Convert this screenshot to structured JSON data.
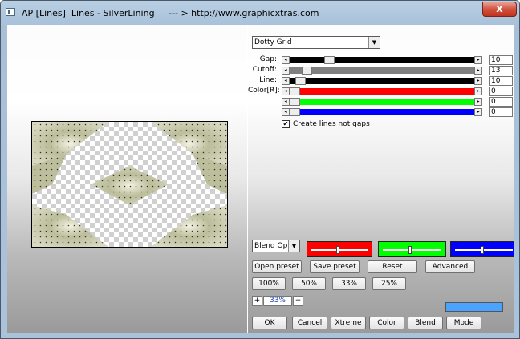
{
  "window": {
    "title": "AP [Lines]  Lines - SilverLining     --- > http://www.graphicxtras.com",
    "close_glyph": "x"
  },
  "effect": {
    "selected": "Dotty Grid"
  },
  "sliders": [
    {
      "label": "Gap:",
      "value": "10",
      "fraction": 0.2,
      "color": "#000000"
    },
    {
      "label": "Cutoff:",
      "value": "13",
      "fraction": 0.07,
      "color": "#808080"
    },
    {
      "label": "Line:",
      "value": "10",
      "fraction": 0.03,
      "color": "#000000"
    },
    {
      "label": "Color[R]:",
      "value": "0",
      "fraction": 0.0,
      "color": "#ff0000"
    },
    {
      "label": "",
      "value": "0",
      "fraction": 0.0,
      "color": "#00ff00"
    },
    {
      "label": "",
      "value": "0",
      "fraction": 0.0,
      "color": "#0000ff"
    }
  ],
  "create_lines": {
    "label": "Create lines not gaps",
    "checked": true
  },
  "blend": {
    "selected": "Blend Optio",
    "red_level": 0.45,
    "green_level": 0.45,
    "blue_level": 0.45
  },
  "preset_buttons": [
    "Open preset",
    "Save preset",
    "Reset",
    "Advanced"
  ],
  "zoom_buttons": [
    "100%",
    "50%",
    "33%",
    "25%"
  ],
  "zoom": {
    "plus": "+",
    "value": "33%",
    "minus": "−"
  },
  "bottom_buttons": [
    "OK",
    "Cancel",
    "Xtreme",
    "Color",
    "Blend",
    "Mode"
  ],
  "swatch_color": "#4aa3ff"
}
